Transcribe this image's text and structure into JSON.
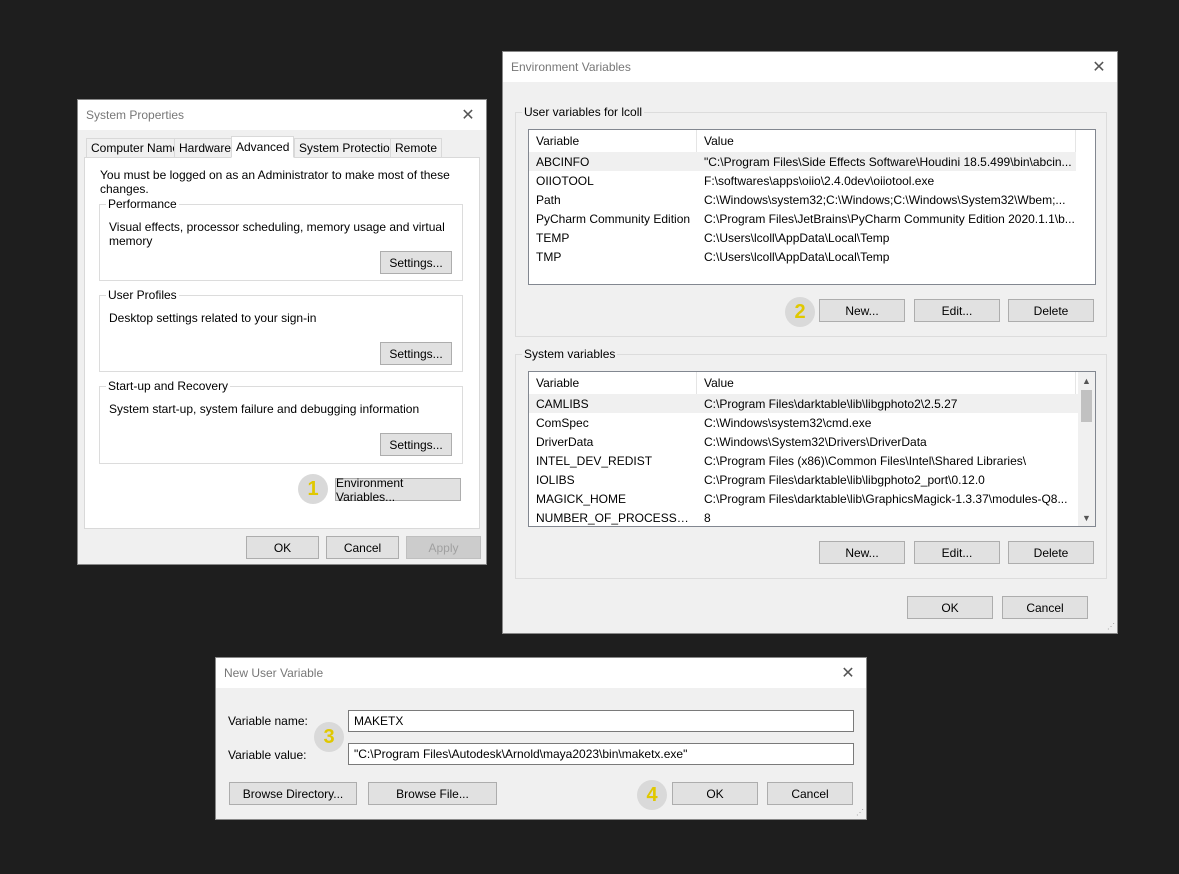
{
  "system_properties": {
    "title": "System Properties",
    "tabs": [
      "Computer Name",
      "Hardware",
      "Advanced",
      "System Protection",
      "Remote"
    ],
    "admin_note": "You must be logged on as an Administrator to make most of these changes.",
    "performance": {
      "title": "Performance",
      "desc": "Visual effects, processor scheduling, memory usage and virtual memory",
      "button": "Settings..."
    },
    "user_profiles": {
      "title": "User Profiles",
      "desc": "Desktop settings related to your sign-in",
      "button": "Settings..."
    },
    "startup": {
      "title": "Start-up and Recovery",
      "desc": "System start-up, system failure and debugging information",
      "button": "Settings..."
    },
    "env_button": "Environment Variables...",
    "ok": "OK",
    "cancel": "Cancel",
    "apply": "Apply"
  },
  "env_vars": {
    "title": "Environment Variables",
    "user_group_title": "User variables for lcoll",
    "col_variable": "Variable",
    "col_value": "Value",
    "user_rows": [
      {
        "var": "ABCINFO",
        "val": "\"C:\\Program Files\\Side Effects Software\\Houdini 18.5.499\\bin\\abcin..."
      },
      {
        "var": "OIIOTOOL",
        "val": "F:\\softwares\\apps\\oiio\\2.4.0dev\\oiiotool.exe"
      },
      {
        "var": "Path",
        "val": "C:\\Windows\\system32;C:\\Windows;C:\\Windows\\System32\\Wbem;..."
      },
      {
        "var": "PyCharm Community Edition",
        "val": "C:\\Program Files\\JetBrains\\PyCharm Community Edition 2020.1.1\\b..."
      },
      {
        "var": "TEMP",
        "val": "C:\\Users\\lcoll\\AppData\\Local\\Temp"
      },
      {
        "var": "TMP",
        "val": "C:\\Users\\lcoll\\AppData\\Local\\Temp"
      }
    ],
    "system_group_title": "System variables",
    "system_rows": [
      {
        "var": "CAMLIBS",
        "val": "C:\\Program Files\\darktable\\lib\\libgphoto2\\2.5.27"
      },
      {
        "var": "ComSpec",
        "val": "C:\\Windows\\system32\\cmd.exe"
      },
      {
        "var": "DriverData",
        "val": "C:\\Windows\\System32\\Drivers\\DriverData"
      },
      {
        "var": "INTEL_DEV_REDIST",
        "val": "C:\\Program Files (x86)\\Common Files\\Intel\\Shared Libraries\\"
      },
      {
        "var": "IOLIBS",
        "val": "C:\\Program Files\\darktable\\lib\\libgphoto2_port\\0.12.0"
      },
      {
        "var": "MAGICK_HOME",
        "val": "C:\\Program Files\\darktable\\lib\\GraphicsMagick-1.3.37\\modules-Q8..."
      },
      {
        "var": "NUMBER_OF_PROCESSORS",
        "val": "8"
      }
    ],
    "new": "New...",
    "edit": "Edit...",
    "delete": "Delete",
    "ok": "OK",
    "cancel": "Cancel"
  },
  "new_user_var": {
    "title": "New User Variable",
    "name_label": "Variable name:",
    "value_label": "Variable value:",
    "name_value": "MAKETX",
    "value_value": "\"C:\\Program Files\\Autodesk\\Arnold\\maya2023\\bin\\maketx.exe\"",
    "browse_dir": "Browse Directory...",
    "browse_file": "Browse File...",
    "ok": "OK",
    "cancel": "Cancel"
  },
  "badges": [
    "1",
    "2",
    "3",
    "4"
  ],
  "icons": {
    "close": "close-icon",
    "scroll_up": "chevron-up-icon",
    "scroll_down": "chevron-down-icon",
    "resize": "resize-grip-icon"
  },
  "colors": {
    "badge_text": "#e0c800",
    "badge_bg": "#d9d9d9",
    "background": "#1e1e1e"
  }
}
